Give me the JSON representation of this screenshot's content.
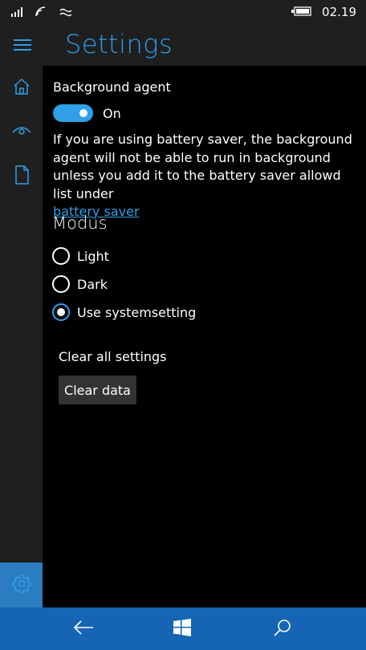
{
  "status": {
    "time": "02.19",
    "icons": [
      "signal-icon",
      "wifi-icon",
      "data-icon",
      "battery-icon"
    ]
  },
  "header": {
    "title": "Settings",
    "menu_icon": "hamburger-icon"
  },
  "sidebar": {
    "items": [
      {
        "icon": "home-icon"
      },
      {
        "icon": "eye-icon"
      },
      {
        "icon": "document-icon"
      },
      {
        "icon": "gear-icon",
        "active": true
      }
    ]
  },
  "settings": {
    "background_agent_label": "Background agent",
    "toggle_state": "On",
    "toggle_on": true,
    "description": "If you are using battery saver, the background agent will not be able to run in background unless you add it to the battery saver allowd list under",
    "link_text": "battery saver",
    "modus_title": "Modus",
    "modes": [
      {
        "label": "Light",
        "checked": false
      },
      {
        "label": "Dark",
        "checked": false
      },
      {
        "label": "Use systemsetting",
        "checked": true
      }
    ],
    "clear_label": "Clear all settings",
    "clear_button": "Clear data"
  },
  "navbar": {
    "items": [
      "back-icon",
      "windows-icon",
      "search-icon"
    ]
  },
  "colors": {
    "accent": "#2f9fe7",
    "nav": "#1565b4",
    "chrome": "#1f1f1f"
  }
}
